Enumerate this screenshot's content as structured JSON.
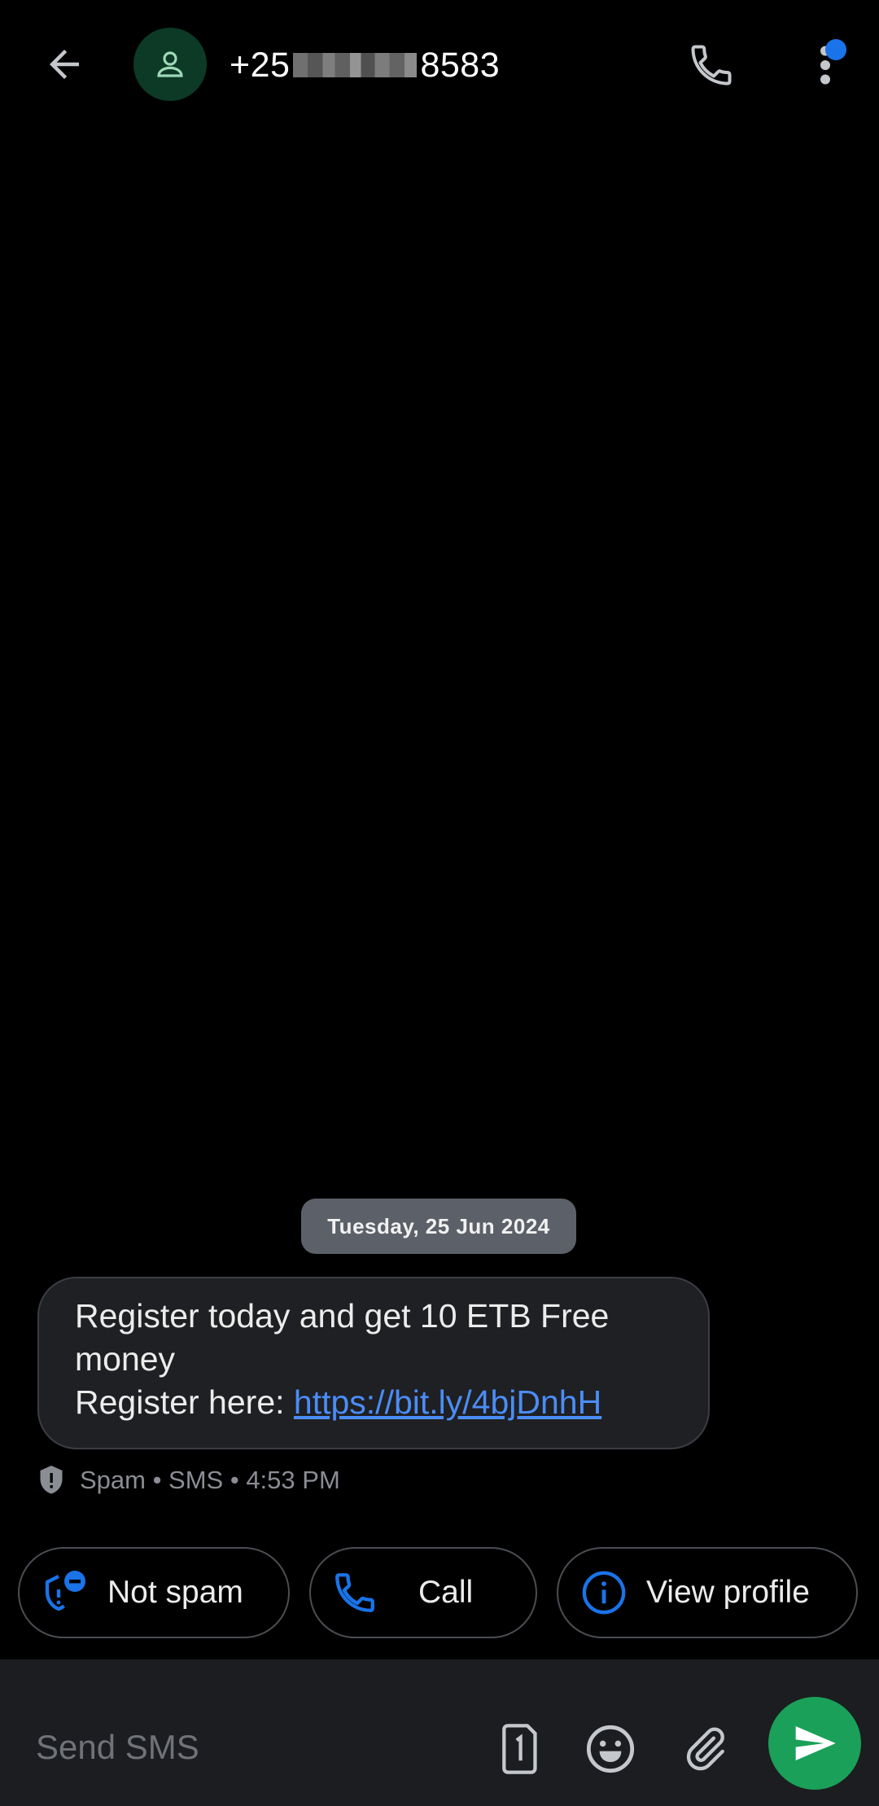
{
  "header": {
    "number_prefix": "+25",
    "number_suffix": "8583",
    "back_icon": "arrow-left-icon",
    "avatar_icon": "person-icon",
    "call_icon": "phone-icon",
    "more_icon": "more-vertical-icon"
  },
  "conversation": {
    "date_label": "Tuesday, 25 Jun 2024",
    "messages": [
      {
        "line1": "Register today and get 10 ETB Free money",
        "line2_prefix": "Register here: ",
        "link": "https://bit.ly/4bjDnhH",
        "meta": "Spam • SMS • 4:53 PM"
      }
    ]
  },
  "actions": {
    "not_spam": "Not spam",
    "call": "Call",
    "view_profile": "View profile"
  },
  "compose": {
    "placeholder": "Send SMS",
    "sim_icon": "sim-1-icon",
    "emoji_icon": "emoji-icon",
    "attach_icon": "paperclip-icon",
    "send_icon": "send-icon"
  },
  "colors": {
    "background": "#000000",
    "accent_blue": "#1a73e8",
    "send_green": "#1aa058",
    "avatar_bg": "#0c3a26",
    "link": "#4b8df8"
  }
}
